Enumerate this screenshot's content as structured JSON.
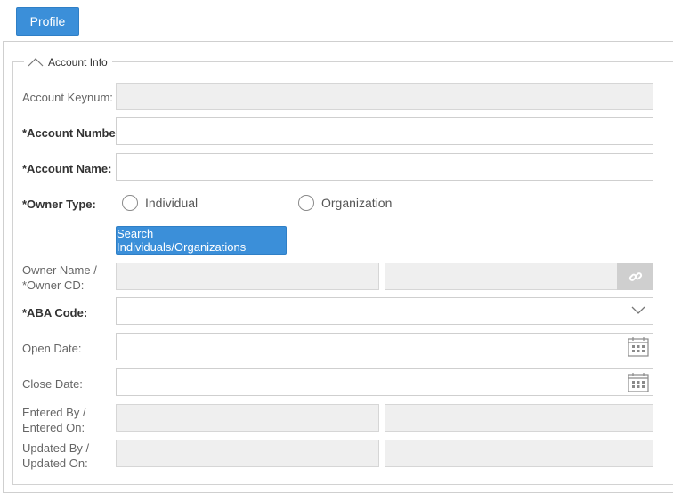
{
  "tabs": {
    "profile_label": "Profile"
  },
  "section": {
    "title": "Account Info"
  },
  "fields": {
    "account_keynum": {
      "label": "Account Keynum:",
      "value": ""
    },
    "account_number": {
      "label": "*Account Number:",
      "value": ""
    },
    "account_name": {
      "label": "*Account Name:",
      "value": ""
    },
    "owner_type": {
      "label": "*Owner Type:",
      "options": [
        "Individual",
        "Organization"
      ],
      "selected": ""
    },
    "search_button_label": "Search Individuals/Organizations",
    "owner": {
      "label_line1": "Owner Name /",
      "label_line2": "*Owner CD:",
      "name": "",
      "cd": ""
    },
    "aba_code": {
      "label": "*ABA Code:",
      "value": ""
    },
    "open_date": {
      "label": "Open Date:",
      "value": ""
    },
    "close_date": {
      "label": "Close Date:",
      "value": ""
    },
    "entered": {
      "label_line1": "Entered By /",
      "label_line2": "Entered On:",
      "by": "",
      "on": ""
    },
    "updated": {
      "label_line1": "Updated By /",
      "label_line2": "Updated On:",
      "by": "",
      "on": ""
    }
  },
  "icons": {
    "collapse": "chevron-up-icon",
    "link": "link-icon",
    "dropdown": "chevron-down-icon",
    "calendar": "calendar-icon"
  },
  "colors": {
    "primary": "#3b8fd9",
    "readonly_bg": "#efefef",
    "border": "#cfcfcf"
  }
}
